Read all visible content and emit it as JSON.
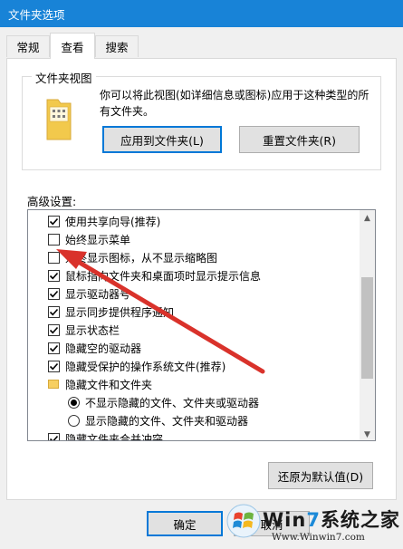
{
  "window": {
    "title": "文件夹选项"
  },
  "tabs": [
    {
      "label": "常规"
    },
    {
      "label": "查看"
    },
    {
      "label": "搜索"
    }
  ],
  "folder_view": {
    "title": "文件夹视图",
    "description": "你可以将此视图(如详细信息或图标)应用于这种类型的所有文件夹。",
    "apply_button": "应用到文件夹(L)",
    "reset_button": "重置文件夹(R)"
  },
  "advanced": {
    "label": "高级设置:",
    "items": [
      {
        "type": "checkbox",
        "checked": true,
        "label": "使用共享向导(推荐)"
      },
      {
        "type": "checkbox",
        "checked": false,
        "label": "始终显示菜单"
      },
      {
        "type": "checkbox",
        "checked": false,
        "label": "始终显示图标，从不显示缩略图"
      },
      {
        "type": "checkbox",
        "checked": true,
        "label": "鼠标指向文件夹和桌面项时显示提示信息"
      },
      {
        "type": "checkbox",
        "checked": true,
        "label": "显示驱动器号"
      },
      {
        "type": "checkbox",
        "checked": true,
        "label": "显示同步提供程序通知"
      },
      {
        "type": "checkbox",
        "checked": true,
        "label": "显示状态栏"
      },
      {
        "type": "checkbox",
        "checked": true,
        "label": "隐藏空的驱动器"
      },
      {
        "type": "checkbox",
        "checked": true,
        "label": "隐藏受保护的操作系统文件(推荐)"
      },
      {
        "type": "folder",
        "label": "隐藏文件和文件夹"
      },
      {
        "type": "radio",
        "checked": true,
        "label": "不显示隐藏的文件、文件夹或驱动器"
      },
      {
        "type": "radio",
        "checked": false,
        "label": "显示隐藏的文件、文件夹和驱动器"
      },
      {
        "type": "checkbox",
        "checked": true,
        "label": "隐藏文件夹合并冲突"
      }
    ],
    "restore_button": "还原为默认值(D)"
  },
  "footer": {
    "ok_button": "确定",
    "cancel_button": "取消"
  },
  "watermark": {
    "brand_prefix": "Win",
    "brand_seven": "7",
    "brand_suffix": "系统之家",
    "url": "Www.Winwin7.com"
  },
  "colors": {
    "titlebar": "#1883d7",
    "annotation_arrow": "#d9322b",
    "accent": "#0078d7"
  }
}
